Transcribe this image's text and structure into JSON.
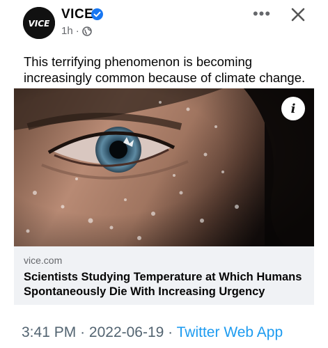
{
  "post": {
    "page_name": "VICE",
    "avatar_text": "VICE",
    "time": "1h",
    "separator": "·",
    "more_label": "•••",
    "caption": "This terrifying phenomenon is becoming increasingly common because of climate change."
  },
  "link_preview": {
    "info_label": "i",
    "domain": "vice.com",
    "headline": "Scientists Studying Temperature at Which Humans Spontaneously Die With Increasing Urgency"
  },
  "tweet_footer": {
    "time": "3:41 PM",
    "sep1": "·",
    "date": "2022-06-19",
    "sep2": "·",
    "app": "Twitter Web App"
  },
  "colors": {
    "verified": "#1877f2",
    "secondary_text": "#65676b",
    "card_bg": "#f0f2f5",
    "twitter_link": "#1d9bf0"
  },
  "icons": {
    "verified": "verified-badge-icon",
    "audience": "globe-icon",
    "close": "close-icon",
    "info": "info-icon"
  }
}
